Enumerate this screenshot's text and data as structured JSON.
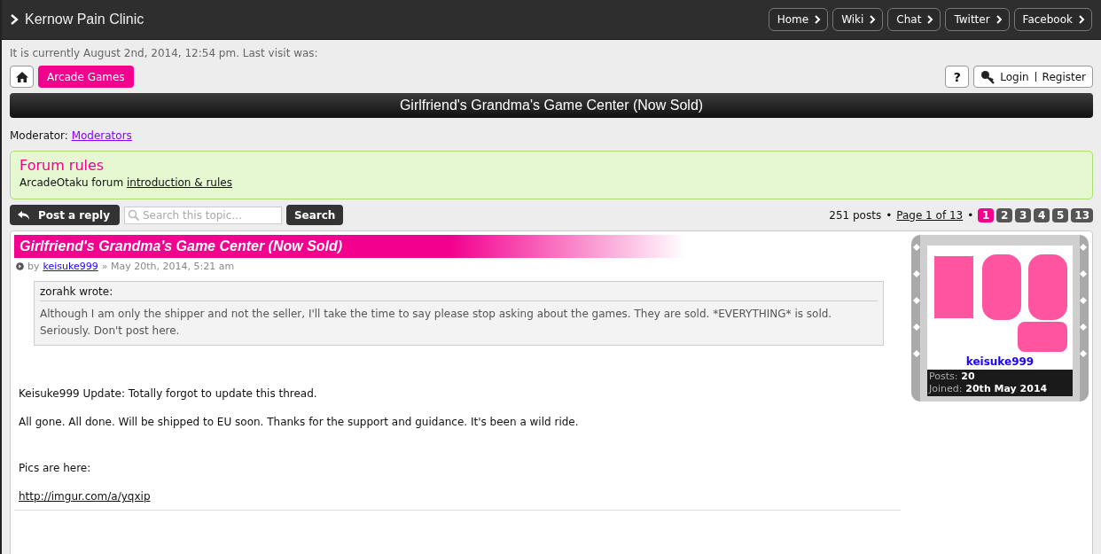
{
  "site_title": "Kernow Pain Clinic",
  "nav_links": [
    "Home",
    "Wiki",
    "Chat",
    "Twitter",
    "Facebook"
  ],
  "current_time": "It is currently August 2nd, 2014, 12:54 pm. Last visit was:",
  "breadcrumb": "Arcade Games",
  "help_button": "?",
  "login": "Login",
  "register": "Register",
  "topic_title": "Girlfriend's Grandma's Game Center (Now Sold)",
  "moderator_label": "Moderator:",
  "moderator_link": "Moderators",
  "rules": {
    "title": "Forum rules",
    "text": "ArcadeOtaku forum",
    "link": "introduction & rules"
  },
  "post_reply": "Post a reply",
  "search": {
    "placeholder": "Search this topic…",
    "button": "Search"
  },
  "pagination": {
    "count": "251 posts",
    "separators": [
      "•",
      "•"
    ],
    "page_link": "Page 1 of 13",
    "pages": [
      {
        "label": "1",
        "selected": true
      },
      {
        "label": "2",
        "selected": false
      },
      {
        "label": "3",
        "selected": false
      },
      {
        "label": "4",
        "selected": false
      },
      {
        "label": "5",
        "selected": false
      },
      {
        "label": "13",
        "selected": false
      }
    ]
  },
  "post": {
    "title": "Girlfriend's Grandma's Game Center (Now Sold)",
    "by": "by",
    "author": "keisuke999",
    "date": "» May 20th, 2014, 5:21 am",
    "quote": {
      "author": "zorahk wrote:",
      "text": "Although I am only the shipper and not the seller, I'll take the time to say please stop asking about the games. They are sold. *EVERYTHING* is sold. Seriously. Don't post here."
    },
    "paragraphs": [
      "Keisuke999 Update: Totally forgot to update this thread.",
      "All gone. All done. Will be shipped to EU soon. Thanks for the support and guidance. It's been a wild ride.",
      "Pics are here:"
    ],
    "link": "http://imgur.com/a/yqxip",
    "profile": {
      "username": "keisuke999",
      "posts_label": "Posts:",
      "posts": "20",
      "joined_label": "Joined:",
      "joined": "20th May 2014"
    }
  }
}
